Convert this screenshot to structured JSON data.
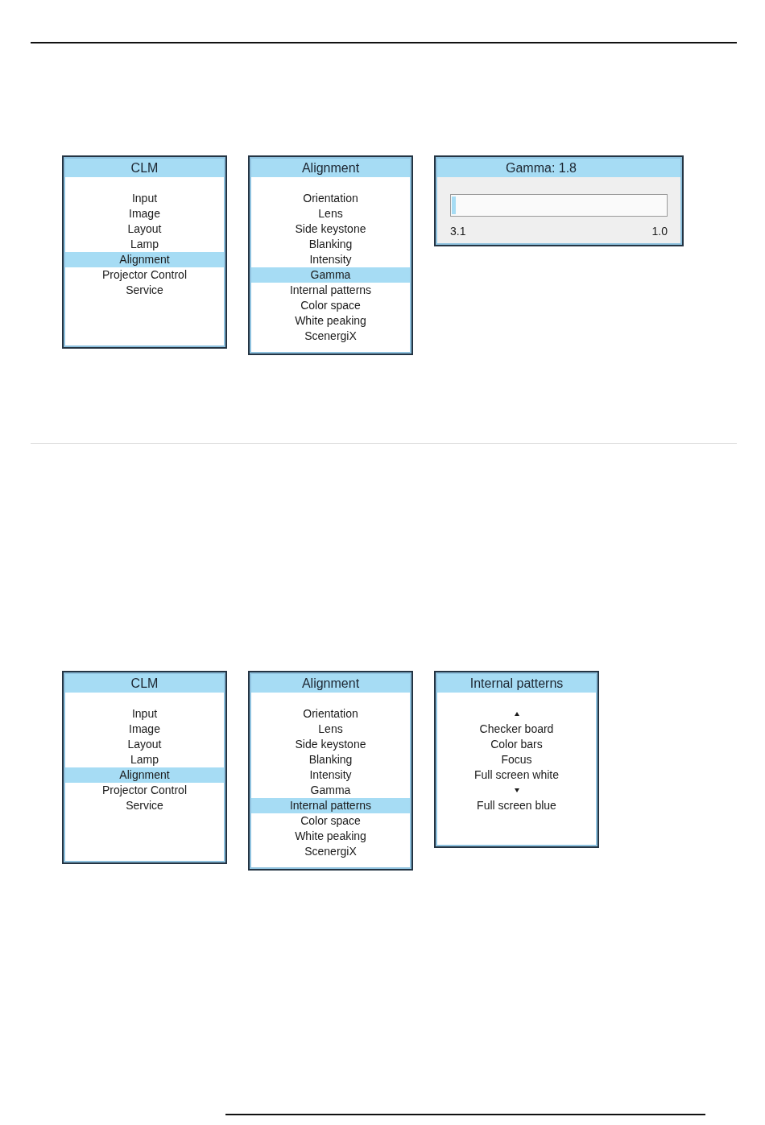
{
  "figures": [
    {
      "panels": [
        {
          "kind": "menu",
          "title": "CLM",
          "items": [
            {
              "kind": "entry",
              "label": "Input",
              "selected": false
            },
            {
              "kind": "entry",
              "label": "Image",
              "selected": false
            },
            {
              "kind": "entry",
              "label": "Layout",
              "selected": false
            },
            {
              "kind": "entry",
              "label": "Lamp",
              "selected": false
            },
            {
              "kind": "entry",
              "label": "Alignment",
              "selected": true
            },
            {
              "kind": "entry",
              "label": "Projector Control",
              "selected": false
            },
            {
              "kind": "entry",
              "label": "Service",
              "selected": false
            }
          ]
        },
        {
          "kind": "menu",
          "title": "Alignment",
          "items": [
            {
              "kind": "entry",
              "label": "Orientation",
              "selected": false
            },
            {
              "kind": "entry",
              "label": "Lens",
              "selected": false
            },
            {
              "kind": "entry",
              "label": "Side keystone",
              "selected": false
            },
            {
              "kind": "entry",
              "label": "Blanking",
              "selected": false
            },
            {
              "kind": "entry",
              "label": "Intensity",
              "selected": false
            },
            {
              "kind": "entry",
              "label": "Gamma",
              "selected": true
            },
            {
              "kind": "entry",
              "label": "Internal patterns",
              "selected": false
            },
            {
              "kind": "entry",
              "label": "Color space",
              "selected": false
            },
            {
              "kind": "entry",
              "label": "White peaking",
              "selected": false
            },
            {
              "kind": "entry",
              "label": "ScenergiX",
              "selected": false
            }
          ]
        },
        {
          "kind": "slider",
          "title": "Gamma: 1.8",
          "level": 0.02,
          "min_label": "3.1",
          "max_label": "1.0"
        }
      ]
    },
    {
      "panels": [
        {
          "kind": "menu",
          "title": "CLM",
          "items": [
            {
              "kind": "entry",
              "label": "Input",
              "selected": false
            },
            {
              "kind": "entry",
              "label": "Image",
              "selected": false
            },
            {
              "kind": "entry",
              "label": "Layout",
              "selected": false
            },
            {
              "kind": "entry",
              "label": "Lamp",
              "selected": false
            },
            {
              "kind": "entry",
              "label": "Alignment",
              "selected": true
            },
            {
              "kind": "entry",
              "label": "Projector Control",
              "selected": false
            },
            {
              "kind": "entry",
              "label": "Service",
              "selected": false
            }
          ]
        },
        {
          "kind": "menu",
          "title": "Alignment",
          "items": [
            {
              "kind": "entry",
              "label": "Orientation",
              "selected": false
            },
            {
              "kind": "entry",
              "label": "Lens",
              "selected": false
            },
            {
              "kind": "entry",
              "label": "Side keystone",
              "selected": false
            },
            {
              "kind": "entry",
              "label": "Blanking",
              "selected": false
            },
            {
              "kind": "entry",
              "label": "Intensity",
              "selected": false
            },
            {
              "kind": "entry",
              "label": "Gamma",
              "selected": false
            },
            {
              "kind": "entry",
              "label": "Internal patterns",
              "selected": true
            },
            {
              "kind": "entry",
              "label": "Color space",
              "selected": false
            },
            {
              "kind": "entry",
              "label": "White peaking",
              "selected": false
            },
            {
              "kind": "entry",
              "label": "ScenergiX",
              "selected": false
            }
          ]
        },
        {
          "kind": "menu",
          "title": "Internal patterns",
          "items": [
            {
              "kind": "scroll_up"
            },
            {
              "kind": "entry",
              "label": "Checker board",
              "selected": false
            },
            {
              "kind": "entry",
              "label": "Color bars",
              "selected": false
            },
            {
              "kind": "entry",
              "label": "Focus",
              "selected": false
            },
            {
              "kind": "entry",
              "label": "Full screen white",
              "selected": false
            },
            {
              "kind": "scroll_down"
            },
            {
              "kind": "entry",
              "label": "Full screen blue",
              "selected": false
            }
          ]
        }
      ]
    }
  ]
}
